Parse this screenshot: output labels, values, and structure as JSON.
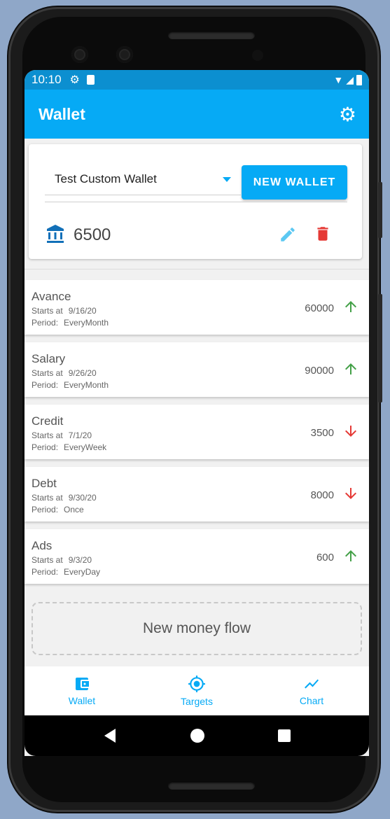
{
  "status": {
    "time": "10:10"
  },
  "appbar": {
    "title": "Wallet"
  },
  "wallet": {
    "selected": "Test Custom Wallet",
    "new_wallet_label": "NEW WALLET",
    "balance": "6500"
  },
  "flows": [
    {
      "name": "Avance",
      "starts_label": "Starts at",
      "starts": "9/16/20",
      "period_label": "Period:",
      "period": "EveryMonth",
      "amount": "60000",
      "direction": "up"
    },
    {
      "name": "Salary",
      "starts_label": "Starts at",
      "starts": "9/26/20",
      "period_label": "Period:",
      "period": "EveryMonth",
      "amount": "90000",
      "direction": "up"
    },
    {
      "name": "Credit",
      "starts_label": "Starts at",
      "starts": "7/1/20",
      "period_label": "Period:",
      "period": "EveryWeek",
      "amount": "3500",
      "direction": "down"
    },
    {
      "name": "Debt",
      "starts_label": "Starts at",
      "starts": "9/30/20",
      "period_label": "Period:",
      "period": "Once",
      "amount": "8000",
      "direction": "down"
    },
    {
      "name": "Ads",
      "starts_label": "Starts at",
      "starts": "9/3/20",
      "period_label": "Period:",
      "period": "EveryDay",
      "amount": "600",
      "direction": "up"
    }
  ],
  "new_flow_label": "New money flow",
  "nav": [
    {
      "label": "Wallet",
      "icon": "wallet-icon"
    },
    {
      "label": "Targets",
      "icon": "target-icon"
    },
    {
      "label": "Chart",
      "icon": "chart-icon"
    }
  ],
  "colors": {
    "primary": "#06aaf5",
    "up": "#43a047",
    "down": "#e53935",
    "delete": "#e53935",
    "bank": "#1270b8"
  }
}
